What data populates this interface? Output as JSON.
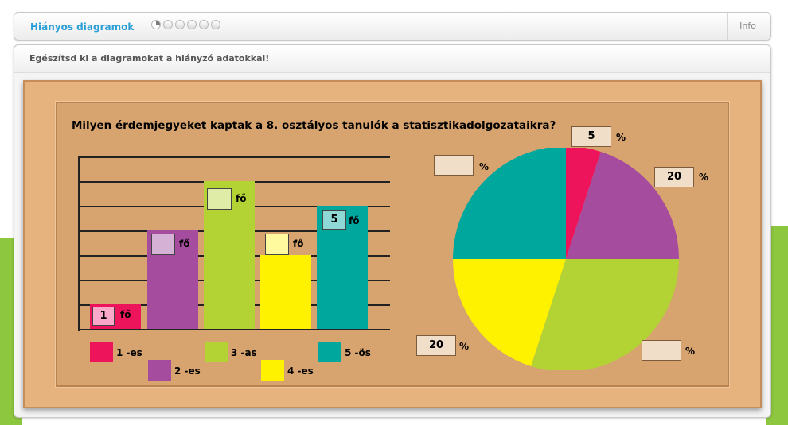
{
  "header": {
    "title": "Hiányos diagramok",
    "info_label": "Info",
    "progress": {
      "total": 6,
      "current": 1
    }
  },
  "instruction": "Egészítsd ki a diagramokat a hiányzó adatokkal!",
  "question": "Milyen érdemjegyeket kaptak a 8. osztályos tanulók a statisztikadolgozataikra?",
  "unit_count": "fő",
  "unit_percent": "%",
  "colors": {
    "g1": "#ed145b",
    "g2": "#a54c9e",
    "g3": "#b3d234",
    "g4": "#fff200",
    "g5": "#00a79d"
  },
  "legend": [
    {
      "label": "1 -es",
      "color": "#ed145b"
    },
    {
      "label": "2 -es",
      "color": "#a54c9e"
    },
    {
      "label": "3 -as",
      "color": "#b3d234"
    },
    {
      "label": "4 -es",
      "color": "#fff200"
    },
    {
      "label": "5 -ös",
      "color": "#00a79d"
    }
  ],
  "chart_data": [
    {
      "type": "bar",
      "categories": [
        "1 -es",
        "2 -es",
        "3 -as",
        "4 -es",
        "5 -ös"
      ],
      "values": [
        1,
        4,
        6,
        3,
        5
      ],
      "shown_inputs": [
        "1",
        "",
        "",
        "",
        "5"
      ],
      "ylim": [
        0,
        7
      ],
      "grid": true
    },
    {
      "type": "pie",
      "labels": [
        "1 -es",
        "2 -es",
        "3 -as",
        "4 -es",
        "5 -ös"
      ],
      "values": [
        5,
        20,
        30,
        20,
        25
      ],
      "shown_inputs": [
        "5",
        "20",
        "",
        "20",
        ""
      ]
    }
  ]
}
